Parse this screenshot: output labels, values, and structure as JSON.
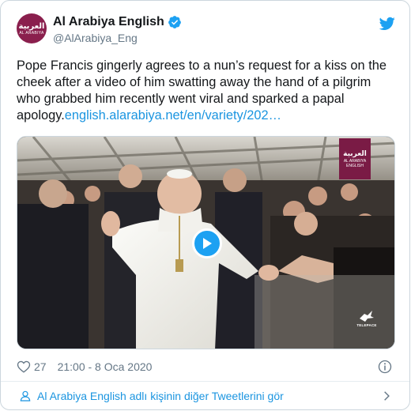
{
  "tweet": {
    "author": {
      "display_name": "Al Arabiya English",
      "handle": "@AlArabiya_Eng",
      "avatar_text_ar": "العربية",
      "avatar_text_en": "AL ARABIYA",
      "verified": true
    },
    "text": "Pope Francis gingerly agrees to a nun’s request for a kiss on the cheek after a video of him swatting away the hand of a pilgrim who grabbed him recently went viral and sparked a papal apology.",
    "link": "english.alarabiya.net/en/variety/202…",
    "media": {
      "type": "video",
      "logo_ar": "العربية",
      "logo_en": "AL ARABIYA ENGLISH",
      "watermark": "TELEPACE"
    },
    "likes": "27",
    "timestamp": "21:00 - 8 Oca 2020",
    "more_tweets_label": "Al Arabiya English adlı kişinin diğer Tweetlerini gör"
  },
  "colors": {
    "link": "#1b95e0",
    "text": "#14171a",
    "muted": "#657786",
    "twitter_blue": "#1da1f2",
    "brand": "#8a1f4d"
  },
  "icons": [
    "twitter-bird-icon",
    "verified-badge-icon",
    "play-icon",
    "heart-icon",
    "info-icon",
    "person-icon",
    "chevron-right-icon"
  ]
}
